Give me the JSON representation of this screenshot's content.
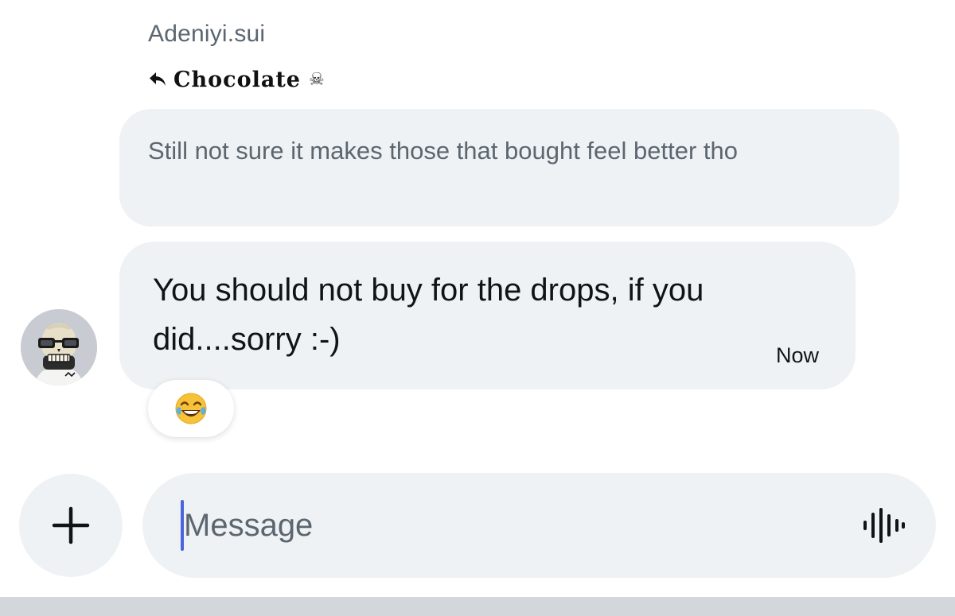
{
  "conversation": {
    "sender_name": "Adeniyi.sui",
    "reply_to": {
      "target_name": "Chocolate",
      "target_emoji": "☠",
      "quoted_text": "Still not sure it makes those that bought feel better tho"
    },
    "message": {
      "text": "You should not buy for the drops, if you did....sorry :-)",
      "timestamp": "Now",
      "reaction": "😂"
    }
  },
  "composer": {
    "placeholder": "Message"
  },
  "icons": {
    "add": "plus-icon",
    "voice": "audio-waveform-icon",
    "reply": "reply-arrow-icon",
    "avatar": "skull-with-glasses-avatar"
  },
  "colors": {
    "bubble_bg": "#eff2f4",
    "muted_text": "#5c6670",
    "primary_text": "#0f1419",
    "caret": "#4c63e0"
  }
}
